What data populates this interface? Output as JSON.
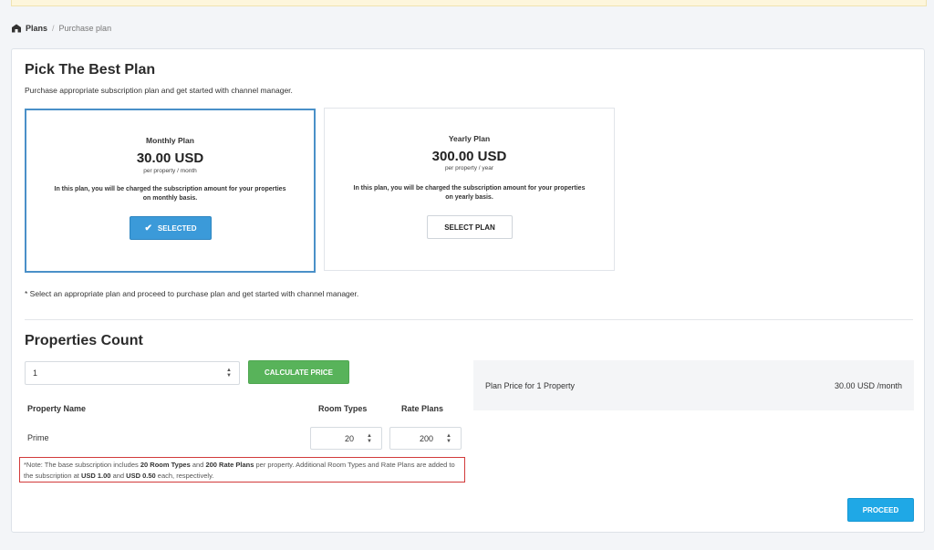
{
  "breadcrumb": {
    "root": "Plans",
    "separator": "/",
    "current": "Purchase plan",
    "icon": "home-icon"
  },
  "pick": {
    "title": "Pick The Best Plan",
    "subtitle": "Purchase appropriate subscription plan and get started with channel manager."
  },
  "plans": [
    {
      "name": "Monthly Plan",
      "price": "30.00 USD",
      "period": "per property / month",
      "description": "In this plan, you will be charged the subscription amount for your properties on monthly basis.",
      "button": "SELECTED",
      "selected": true
    },
    {
      "name": "Yearly Plan",
      "price": "300.00 USD",
      "period": "per property / year",
      "description": "In this plan, you will be charged the subscription amount for your properties on yearly basis.",
      "button": "SELECT PLAN",
      "selected": false
    }
  ],
  "plan_note": "* Select an appropriate plan and proceed to purchase plan and get started with channel manager.",
  "properties": {
    "title": "Properties Count",
    "count_value": "1",
    "calculate_label": "CALCULATE PRICE",
    "columns": {
      "name": "Property Name",
      "room_types": "Room Types",
      "rate_plans": "Rate Plans"
    },
    "rows": [
      {
        "name": "Prime",
        "room_types": "20",
        "rate_plans": "200"
      }
    ],
    "note": {
      "p1": "*Note: The base subscription includes ",
      "b1": "20 Room Types",
      "p2": " and ",
      "b2": "200 Rate Plans",
      "p3": " per property. Additional Room Types and Rate Plans are added to the subscription at ",
      "b3": "USD 1.00",
      "p4": " and ",
      "b4": "USD 0.50",
      "p5": " each, respectively."
    }
  },
  "summary": {
    "label": "Plan Price for 1 Property",
    "value": "30.00 USD  /month"
  },
  "proceed_label": "PROCEED",
  "colors": {
    "selected": "#3b9ad9",
    "calculate": "#58b35a",
    "proceed": "#1fa8e6",
    "note_border": "#d23a3a"
  }
}
